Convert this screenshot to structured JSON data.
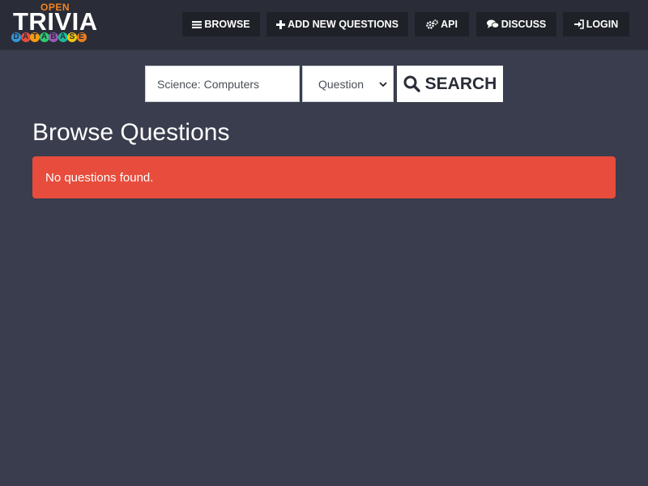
{
  "logo": {
    "open": "OPEN",
    "trivia": "TRIVIA",
    "database_letters": [
      "D",
      "A",
      "T",
      "A",
      "B",
      "A",
      "S",
      "E"
    ],
    "database_colors": [
      "#3498db",
      "#e74c3c",
      "#f39c12",
      "#2ecc71",
      "#9b59b6",
      "#1abc9c",
      "#f1c40f",
      "#e67e22"
    ]
  },
  "nav": {
    "browse": {
      "label": "BROWSE",
      "icon": "bars-icon"
    },
    "add": {
      "label": "ADD NEW QUESTIONS",
      "icon": "plus-icon"
    },
    "api": {
      "label": "API",
      "icon": "cogs-icon"
    },
    "discuss": {
      "label": "DISCUSS",
      "icon": "comments-icon"
    },
    "login": {
      "label": "LOGIN",
      "icon": "sign-in-icon"
    }
  },
  "search": {
    "query": "Science: Computers",
    "type_selected": "Question",
    "button_label": "SEARCH"
  },
  "page": {
    "title": "Browse Questions",
    "alert": "No questions found.",
    "alert_color": "#e74c3c",
    "background": "#393d4d"
  }
}
